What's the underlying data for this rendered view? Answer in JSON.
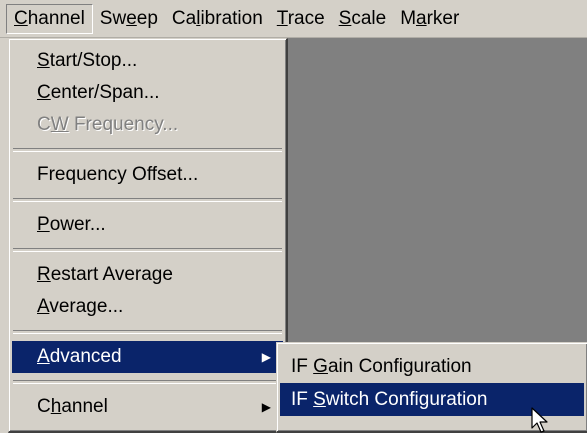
{
  "menubar": {
    "items": [
      {
        "pre": "",
        "u": "C",
        "post": "hannel"
      },
      {
        "pre": "Sw",
        "u": "e",
        "post": "ep"
      },
      {
        "pre": "Ca",
        "u": "l",
        "post": "ibration"
      },
      {
        "pre": "",
        "u": "T",
        "post": "race"
      },
      {
        "pre": "",
        "u": "S",
        "post": "cale"
      },
      {
        "pre": "M",
        "u": "a",
        "post": "rker"
      }
    ]
  },
  "channel_menu": {
    "items": [
      {
        "pre": "",
        "u": "S",
        "post": "tart/Stop..."
      },
      {
        "pre": "",
        "u": "C",
        "post": "enter/Span..."
      },
      {
        "pre": "C",
        "u": "W",
        "post": " Frequency..."
      },
      {
        "pre": "",
        "u": "",
        "post": "Frequency Offset..."
      },
      {
        "pre": "",
        "u": "P",
        "post": "ower..."
      },
      {
        "pre": "",
        "u": "R",
        "post": "estart Average"
      },
      {
        "pre": "",
        "u": "A",
        "post": "verage..."
      },
      {
        "pre": "",
        "u": "A",
        "post": "dvanced"
      },
      {
        "pre": "C",
        "u": "h",
        "post": "annel"
      }
    ]
  },
  "advanced_submenu": {
    "items": [
      {
        "pre": "IF ",
        "u": "G",
        "post": "ain Configuration"
      },
      {
        "pre": "IF ",
        "u": "S",
        "post": "witch Configuration"
      }
    ]
  },
  "icons": {
    "submenu_arrow": "▶"
  },
  "colors": {
    "menu_bg": "#d4d0c8",
    "highlight": "#0a246a",
    "workspace": "#808080",
    "disabled_text": "#808080"
  }
}
